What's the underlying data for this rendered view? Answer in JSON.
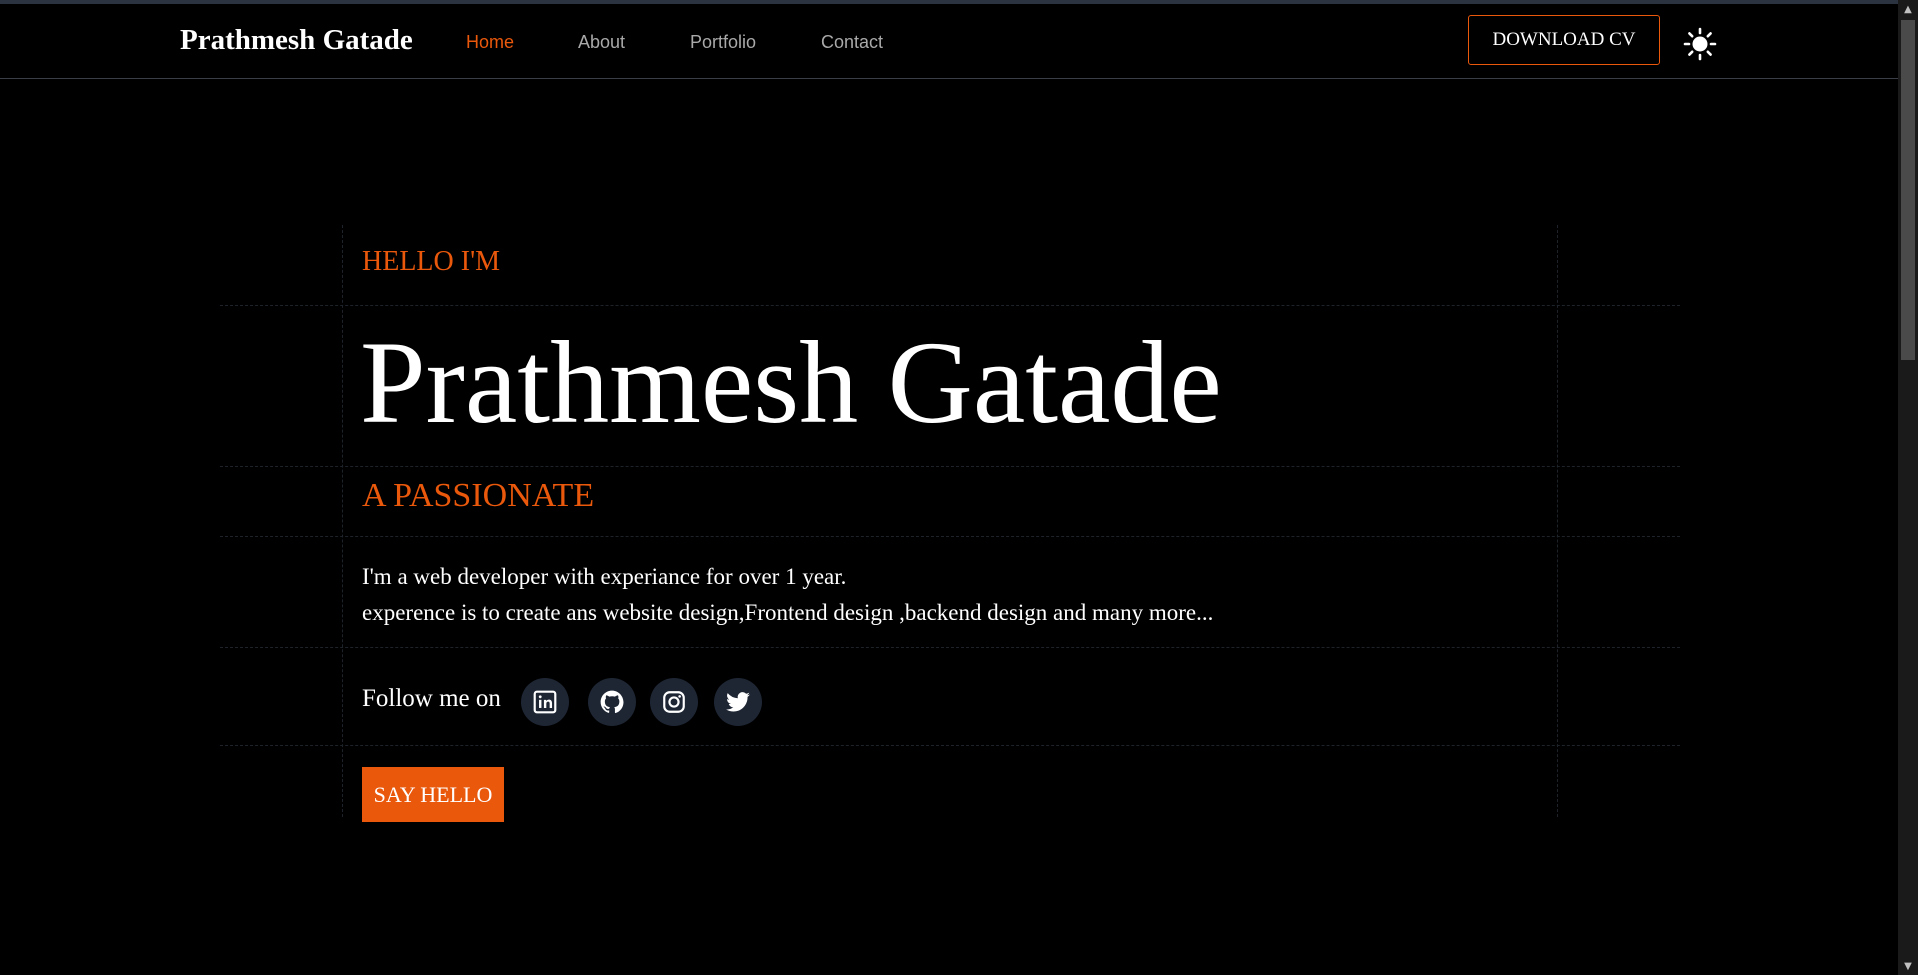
{
  "navbar": {
    "brand": "Prathmesh Gatade",
    "links": [
      {
        "label": "Home",
        "active": true
      },
      {
        "label": "About",
        "active": false
      },
      {
        "label": "Portfolio",
        "active": false
      },
      {
        "label": "Contact",
        "active": false
      }
    ],
    "download_cv_label": "DOWNLOAD CV",
    "theme_icon": "sun-icon"
  },
  "hero": {
    "greeting": "HELLO I'M",
    "name": "Prathmesh Gatade",
    "tagline": "A PASSIONATE",
    "description": [
      "I'm a web developer with experiance for over 1 year.",
      "experence is to create ans website design,Frontend design ,backend design and many more..."
    ],
    "follow_label": "Follow me on",
    "socials": [
      "linkedin-icon",
      "github-icon",
      "instagram-icon",
      "twitter-icon"
    ],
    "cta_label": "SAY HELLO"
  },
  "colors": {
    "accent": "#ea580c",
    "background": "#000000",
    "social_bg": "#1e2634"
  }
}
